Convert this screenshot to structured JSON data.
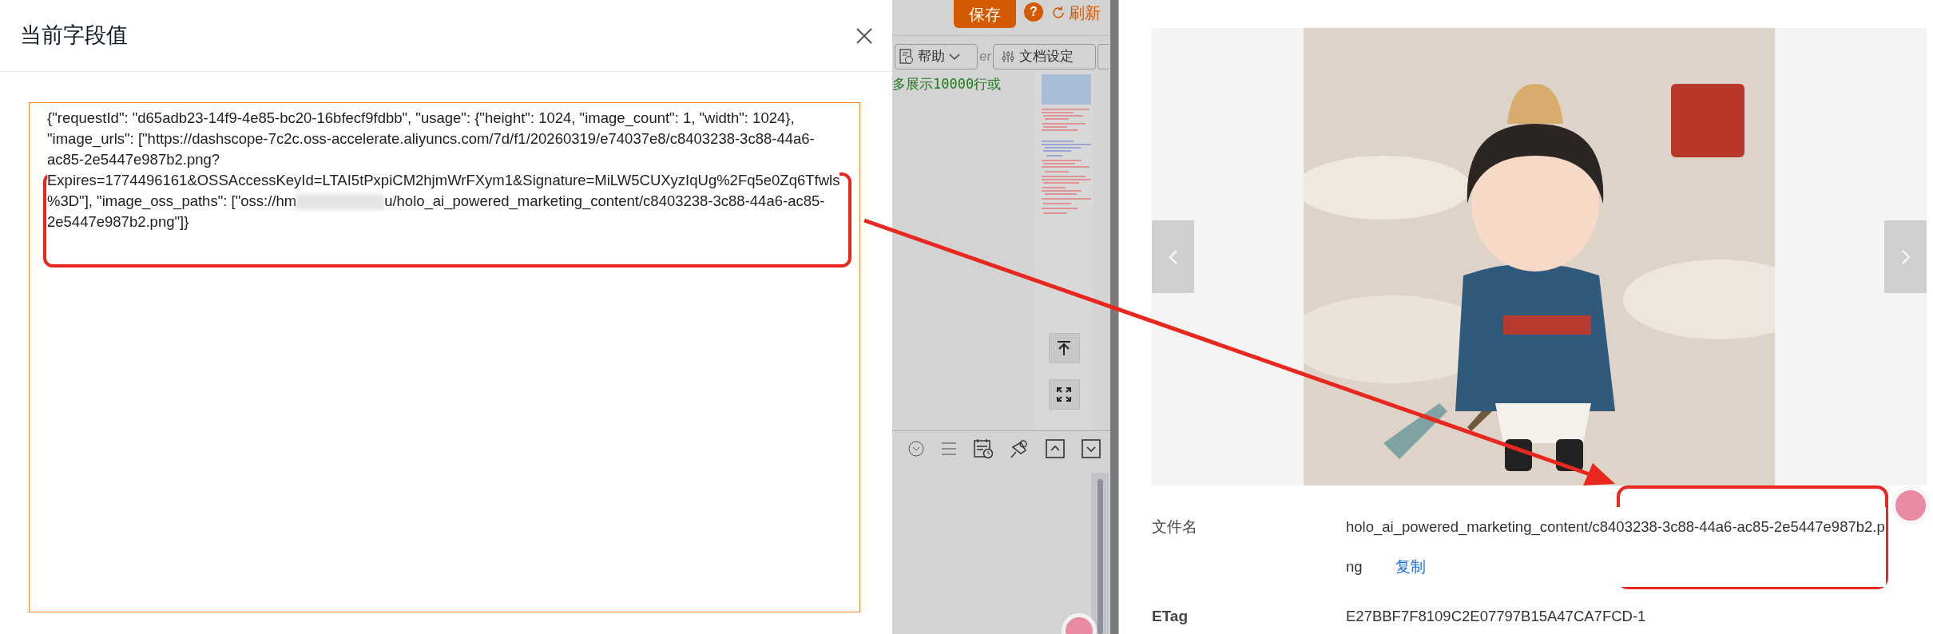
{
  "dialog": {
    "title": "当前字段值",
    "field": {
      "value_before": "{\"requestId\": \"d65adb23-14f9-4e85-bc20-16bfecf9fdbb\", \"usage\": {\"height\": 1024, \"image_count\": 1, \"width\": 1024}, \"image_urls\": [\"https://dashscope-7c2c.oss-accelerate.aliyuncs.com/7d/f1/20260319/e74037e8/c8403238-3c88-44a6-ac85-2e5447e987b2.png?Expires=1774496161&OSSAccessKeyId=LTAI5tPxpiCM2hjmWrFXym1&Signature=MiLW5CUXyzIqUg%2Fq5e0Zq6Tfwls%3D\"], \"image_oss_paths\": [\"oss://hm",
      "redacted": true,
      "value_after": "u/holo_ai_powered_marketing_content/c8403238-3c88-44a6-ac85-2e5447e987b2.png\"]}"
    }
  },
  "editor": {
    "toolbar": {
      "save": "保存",
      "help_mark": "?",
      "refresh": "刷新",
      "help_menu": "帮助",
      "partial_label": "er",
      "doc_settings": "文档设定"
    },
    "notice": "多展示10000行或"
  },
  "object_detail": {
    "rows": [
      {
        "label": "文件名",
        "value": "holo_ai_powered_marketing_content/c8403238-3c88-44a6-ac85-2e5447e987b2.png",
        "action": "复制",
        "bold_label": false
      },
      {
        "label": "ETag",
        "value": "E27BBF7F8109C2E07797B15A47CA7FCD-1",
        "bold_label": true
      }
    ]
  }
}
